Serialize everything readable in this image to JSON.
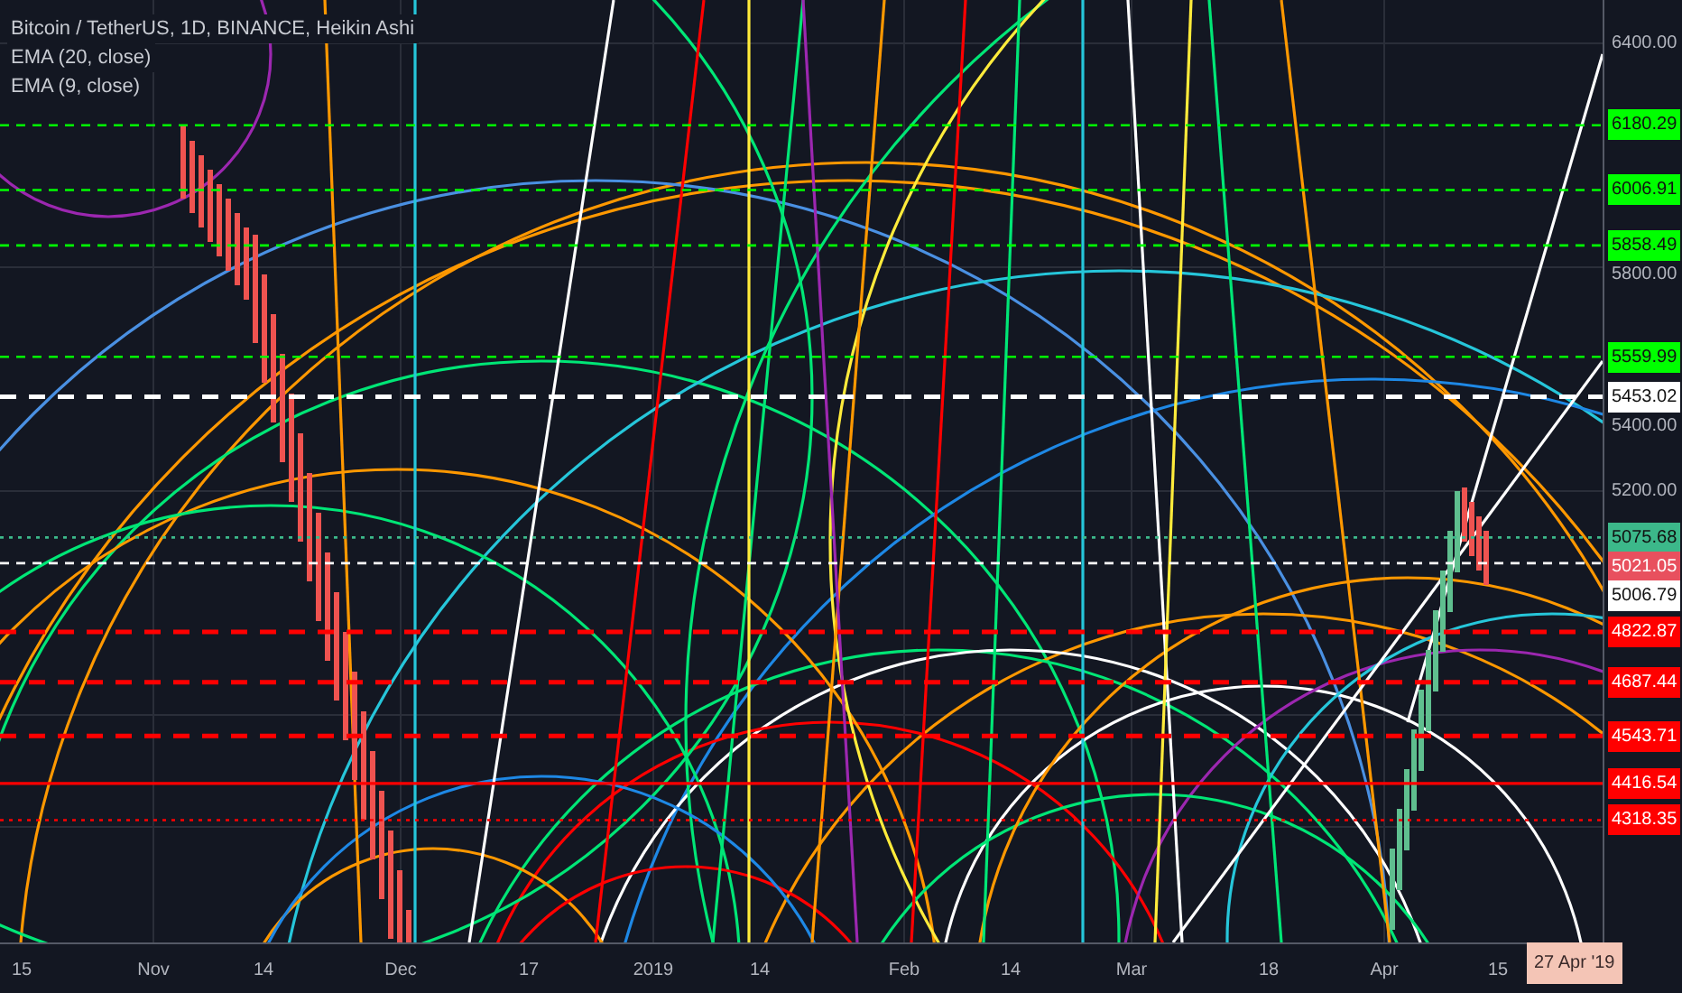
{
  "legend": [
    "Bitcoin / TetherUS, 1D, BINANCE, Heikin Ashi",
    "EMA (20, close)",
    "EMA (9, close)"
  ],
  "price_axis": [
    {
      "text": "6400.00",
      "kind": "tick"
    },
    {
      "text": "6180.29",
      "kind": "dashed",
      "color": "#00ff00"
    },
    {
      "text": "6006.91",
      "kind": "dashed",
      "color": "#00ff00"
    },
    {
      "text": "5858.49",
      "kind": "dashed",
      "color": "#00ff00"
    },
    {
      "text": "5800.00",
      "kind": "tick"
    },
    {
      "text": "5559.99",
      "kind": "dashed",
      "color": "#00ff00"
    },
    {
      "text": "5453.02",
      "kind": "wide",
      "color": "#ffffff"
    },
    {
      "text": "5400.00",
      "kind": "tick"
    },
    {
      "text": "5200.00",
      "kind": "tick"
    },
    {
      "text": "5075.68",
      "kind": "dotted",
      "color": "#3cb88a"
    },
    {
      "text": "5021.05",
      "kind": "plain",
      "color": "#e8505e"
    },
    {
      "text": "5006.79",
      "kind": "dashed",
      "color": "#ffffff"
    },
    {
      "text": "4822.87",
      "kind": "wide",
      "color": "#ff0000"
    },
    {
      "text": "4687.44",
      "kind": "wide",
      "color": "#ff0000"
    },
    {
      "text": "4543.71",
      "kind": "wide",
      "color": "#ff0000"
    },
    {
      "text": "4416.54",
      "kind": "solid",
      "color": "#ff0000"
    },
    {
      "text": "4318.35",
      "kind": "dotted",
      "color": "#ff0000"
    }
  ],
  "time_axis": [
    "15",
    "Nov",
    "14",
    "Dec",
    "17",
    "2019",
    "14",
    "Feb",
    "14",
    "Mar",
    "18",
    "Apr",
    "15"
  ],
  "crosshair_date": "27 Apr '19"
}
